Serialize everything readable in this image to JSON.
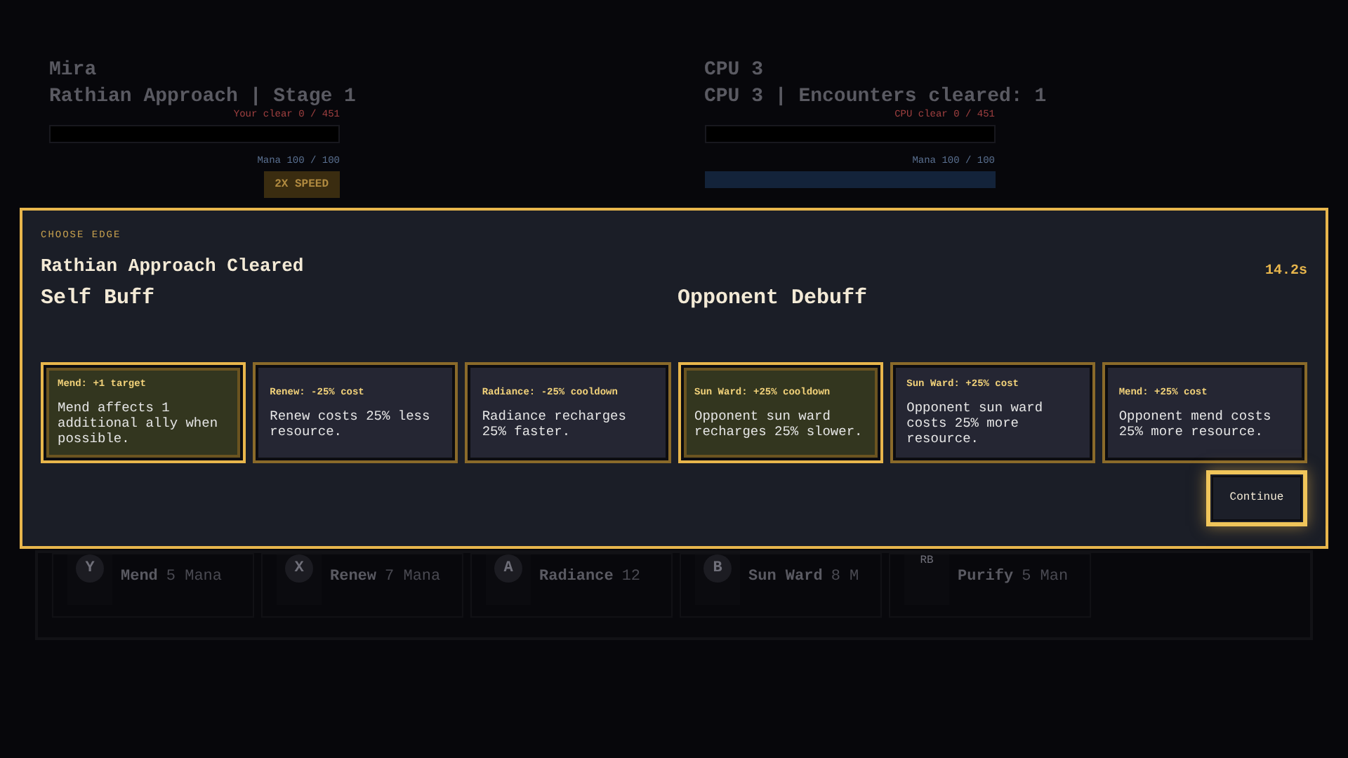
{
  "players": [
    {
      "name": "Mira",
      "subtitle": "Rathian Approach | Stage 1",
      "clear": "Your clear 0 / 451",
      "mana": "Mana 100 / 100",
      "kind": "human",
      "speed_button": "2X SPEED"
    },
    {
      "name": "CPU 3",
      "subtitle": "CPU 3 | Encounters cleared: 1",
      "clear": "CPU clear 0 / 451",
      "mana": "Mana 100 / 100",
      "kind": "cpu"
    }
  ],
  "skills": [
    {
      "kind": "round",
      "key": "Y",
      "name": "Mend",
      "cost": "5 Mana"
    },
    {
      "kind": "round",
      "key": "X",
      "name": "Renew",
      "cost": "7 Mana"
    },
    {
      "kind": "round",
      "key": "A",
      "name": "Radiance",
      "cost": "12"
    },
    {
      "kind": "round",
      "key": "B",
      "name": "Sun Ward",
      "cost": "8 M"
    },
    {
      "kind": "square",
      "key": "RB",
      "name": "Purify",
      "cost": "5 Man"
    }
  ],
  "modal": {
    "eyebrow": "CHOOSE EDGE",
    "title": "Rathian Approach Cleared",
    "timer": "14.2s",
    "groups": [
      {
        "heading": "Self Buff",
        "options": [
          {
            "title": "Mend: +1 target",
            "description": "Mend affects 1 additional ally when possible.",
            "selected": true
          },
          {
            "title": "Renew: -25% cost",
            "description": "Renew costs 25% less resource.",
            "selected": false
          },
          {
            "title": "Radiance: -25% cooldown",
            "description": "Radiance recharges 25% faster.",
            "selected": false
          }
        ]
      },
      {
        "heading": "Opponent Debuff",
        "options": [
          {
            "title": "Sun Ward: +25% cooldown",
            "description": "Opponent sun ward recharges 25% slower.",
            "selected": true
          },
          {
            "title": "Sun Ward: +25% cost",
            "description": "Opponent sun ward costs 25% more resource.",
            "selected": false
          },
          {
            "title": "Mend: +25% cost",
            "description": "Opponent mend costs 25% more resource.",
            "selected": false
          }
        ]
      }
    ],
    "continue": "Continue"
  }
}
